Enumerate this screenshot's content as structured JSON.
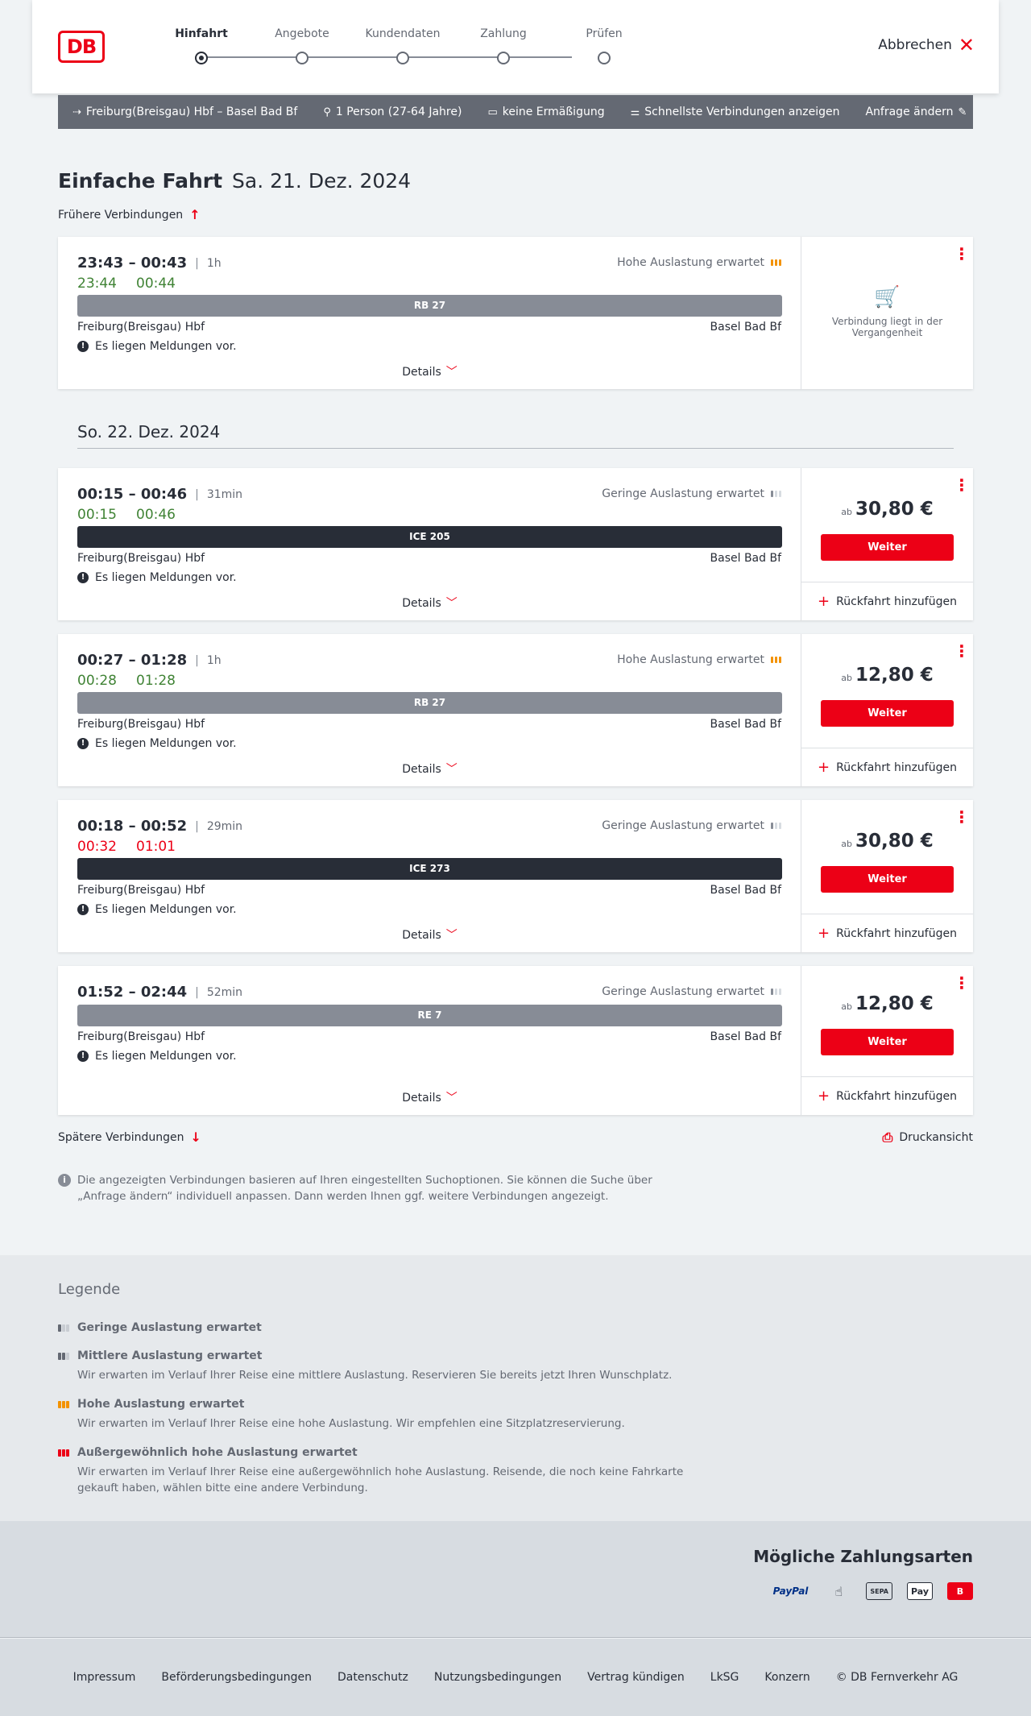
{
  "header": {
    "logo": "DB",
    "steps": [
      "Hinfahrt",
      "Angebote",
      "Kundendaten",
      "Zahlung",
      "Prüfen"
    ],
    "cancel": "Abbrechen"
  },
  "summary": {
    "route": "Freiburg(Breisgau) Hbf – Basel Bad Bf",
    "persons": "1 Person (27-64 Jahre)",
    "discount": "keine Ermäßigung",
    "fastest": "Schnellste Verbindungen anzeigen",
    "change": "Anfrage ändern"
  },
  "title": {
    "main": "Einfache Fahrt",
    "date": "Sa. 21. Dez. 2024"
  },
  "earlier": "Frühere Verbindungen",
  "later": "Spätere Verbindungen",
  "print": "Druckansicht",
  "day2": "So. 22. Dez. 2024",
  "connections": [
    {
      "times": "23:43 – 00:43",
      "duration": "1h",
      "rt_dep": "23:44",
      "rt_arr": "00:44",
      "load": "Hohe Auslastung erwartet",
      "train": "RB 27",
      "from": "Freiburg(Breisgau) Hbf",
      "to": "Basel Bad Bf",
      "message": "Es liegen Meldungen vor.",
      "details": "Details",
      "past": "Verbindung liegt in der Vergangenheit"
    },
    {
      "times": "00:15 – 00:46",
      "duration": "31min",
      "rt_dep": "00:15",
      "rt_arr": "00:46",
      "load": "Geringe Auslastung erwartet",
      "train": "ICE 205",
      "from": "Freiburg(Breisgau) Hbf",
      "to": "Basel Bad Bf",
      "message": "Es liegen Meldungen vor.",
      "details": "Details",
      "ab": "ab",
      "price": "30,80 €",
      "weiter": "Weiter",
      "return": "Rückfahrt hinzufügen"
    },
    {
      "times": "00:27 – 01:28",
      "duration": "1h",
      "rt_dep": "00:28",
      "rt_arr": "01:28",
      "load": "Hohe Auslastung erwartet",
      "train": "RB 27",
      "from": "Freiburg(Breisgau) Hbf",
      "to": "Basel Bad Bf",
      "message": "Es liegen Meldungen vor.",
      "details": "Details",
      "ab": "ab",
      "price": "12,80 €",
      "weiter": "Weiter",
      "return": "Rückfahrt hinzufügen"
    },
    {
      "times": "00:18 – 00:52",
      "duration": "29min",
      "rt_dep": "00:32",
      "rt_arr": "01:01",
      "load": "Geringe Auslastung erwartet",
      "train": "ICE 273",
      "from": "Freiburg(Breisgau) Hbf",
      "to": "Basel Bad Bf",
      "message": "Es liegen Meldungen vor.",
      "details": "Details",
      "ab": "ab",
      "price": "30,80 €",
      "weiter": "Weiter",
      "return": "Rückfahrt hinzufügen"
    },
    {
      "times": "01:52 – 02:44",
      "duration": "52min",
      "load": "Geringe Auslastung erwartet",
      "train": "RE 7",
      "from": "Freiburg(Breisgau) Hbf",
      "to": "Basel Bad Bf",
      "message": "Es liegen Meldungen vor.",
      "details": "Details",
      "ab": "ab",
      "price": "12,80 €",
      "weiter": "Weiter",
      "return": "Rückfahrt hinzufügen"
    }
  ],
  "info": "Die angezeigten Verbindungen basieren auf Ihren eingestellten Suchoptionen. Sie können die Suche über „Anfrage ändern“ individuell anpassen. Dann werden Ihnen ggf. weitere Verbindungen angezeigt.",
  "legend": {
    "title": "Legende",
    "items": [
      {
        "title": "Geringe Auslastung erwartet",
        "desc": ""
      },
      {
        "title": "Mittlere Auslastung erwartet",
        "desc": "Wir erwarten im Verlauf Ihrer Reise eine mittlere Auslastung. Reservieren Sie bereits jetzt Ihren Wunschplatz."
      },
      {
        "title": "Hohe Auslastung erwartet",
        "desc": "Wir erwarten im Verlauf Ihrer Reise eine hohe Auslastung. Wir empfehlen eine Sitzplatzreservierung."
      },
      {
        "title": "Außergewöhnlich hohe Auslastung erwartet",
        "desc": "Wir erwarten im Verlauf Ihrer Reise eine außergewöhnlich hohe Auslastung. Reisende, die noch keine Fahrkarte gekauft haben, wählen bitte eine andere Verbindung."
      }
    ]
  },
  "payments": {
    "title": "Mögliche Zahlungsarten",
    "paypal": "PayPal",
    "sepa": "SEPA",
    "apple": "Pay"
  },
  "footer": [
    "Impressum",
    "Beförderungsbedingungen",
    "Datenschutz",
    "Nutzungsbedingungen",
    "Vertrag kündigen",
    "LkSG",
    "Konzern",
    "© DB Fernverkehr AG"
  ],
  "colors": {
    "accent": "#ec0016",
    "dark": "#282d37",
    "grey": "#878c96",
    "green": "#408335",
    "orange": "#f39200"
  }
}
